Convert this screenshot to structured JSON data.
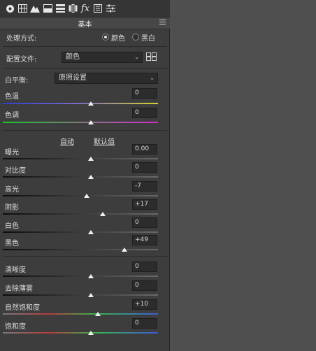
{
  "panel": {
    "title": "基本"
  },
  "toolbar": {
    "icons": [
      "aperture-icon",
      "tone-curve-icon",
      "mountain-icon",
      "split-toning-icon",
      "hsl-icon",
      "lens-icon",
      "fx-icon",
      "camera-calibration-icon",
      "presets-icon"
    ],
    "fx_label": "fx"
  },
  "treatment": {
    "label": "处理方式:",
    "option_color": "颜色",
    "option_bw": "黑白",
    "selected": "颜色"
  },
  "profile": {
    "label": "配置文件:",
    "value": "颜色"
  },
  "white_balance": {
    "label": "白平衡:",
    "value": "原照设置"
  },
  "links": {
    "auto": "自动",
    "default": "默认值"
  },
  "sliders": {
    "temperature": {
      "label": "色温",
      "value": "0"
    },
    "tint": {
      "label": "色调",
      "value": "0"
    },
    "exposure": {
      "label": "曝光",
      "value": "0.00"
    },
    "contrast": {
      "label": "对比度",
      "value": "0"
    },
    "highlights": {
      "label": "高光",
      "value": "-7"
    },
    "shadows": {
      "label": "阴影",
      "value": "+17"
    },
    "whites": {
      "label": "白色",
      "value": "0"
    },
    "blacks": {
      "label": "黑色",
      "value": "+49"
    },
    "clarity": {
      "label": "清晰度",
      "value": "0"
    },
    "dehaze": {
      "label": "去除薄雾",
      "value": "0"
    },
    "vibrance": {
      "label": "自然饱和度",
      "value": "+10"
    },
    "saturation": {
      "label": "饱和度",
      "value": "0"
    }
  }
}
